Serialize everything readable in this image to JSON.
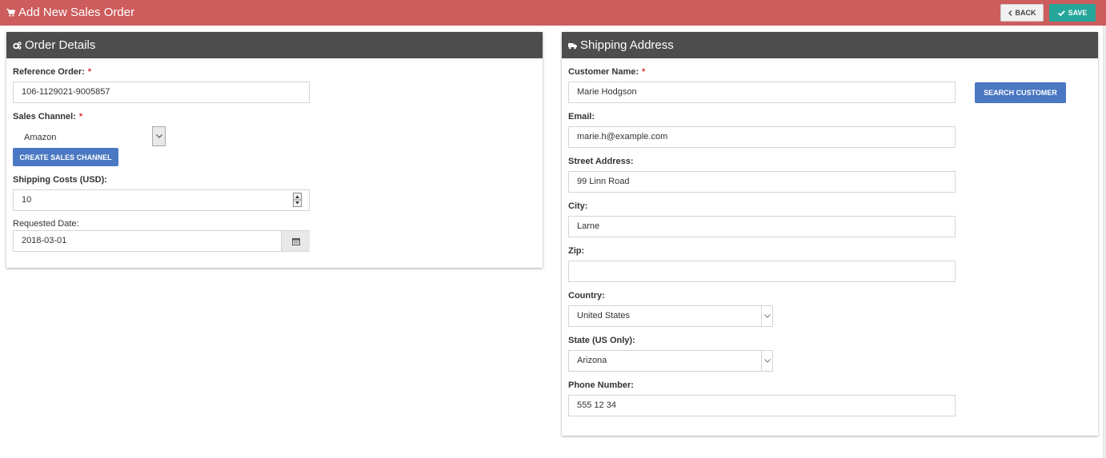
{
  "header": {
    "title": "Add New Sales Order",
    "back_label": "BACK",
    "save_label": "SAVE"
  },
  "order_details": {
    "title": "Order Details",
    "reference_label": "Reference Order:",
    "reference_value": "106-1129021-9005857",
    "channel_label": "Sales Channel:",
    "channel_value": "Amazon",
    "create_channel_label": "CREATE SALES CHANNEL",
    "shipping_label": "Shipping Costs (USD):",
    "shipping_value": "10",
    "date_label": "Requested Date:",
    "date_value": "2018-03-01"
  },
  "shipping_address": {
    "title": "Shipping Address",
    "customer_label": "Customer Name:",
    "customer_value": "Marie Hodgson",
    "search_customer_label": "SEARCH CUSTOMER",
    "email_label": "Email:",
    "email_value": "marie.h@example.com",
    "street_label": "Street Address:",
    "street_value": "99 Linn Road",
    "city_label": "City:",
    "city_value": "Larne",
    "zip_label": "Zip:",
    "zip_value": "",
    "country_label": "Country:",
    "country_value": "United States",
    "state_label": "State (US Only):",
    "state_value": "Arizona",
    "phone_label": "Phone Number:",
    "phone_value": "555 12 34"
  },
  "required_marker": "*",
  "colors": {
    "header_bg": "#cd5c5c",
    "panel_head": "#4d4d4d",
    "save": "#26a69a",
    "primary_button": "#4a78c2",
    "required": "#d9342b"
  }
}
